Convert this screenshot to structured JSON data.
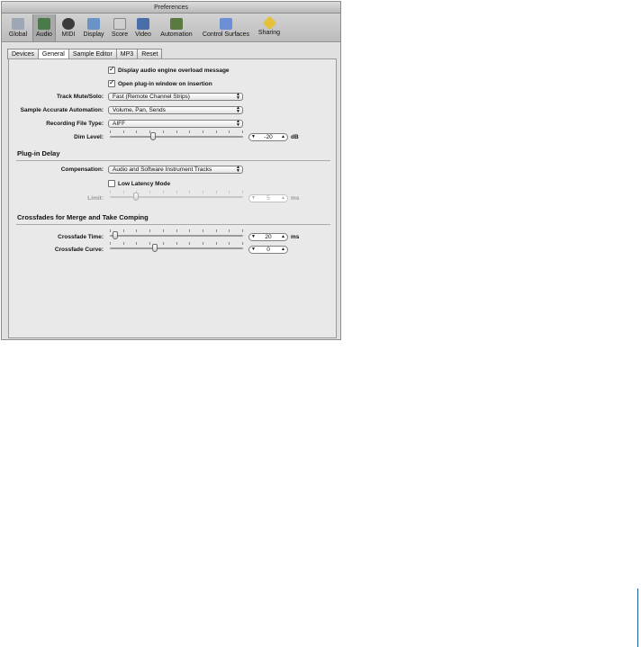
{
  "window": {
    "title": "Preferences"
  },
  "toolbar": [
    {
      "label": "Global",
      "icon": "global-icon",
      "color": "#9ea7b5"
    },
    {
      "label": "Audio",
      "icon": "audio-icon",
      "color": "#4a7a4a"
    },
    {
      "label": "MIDI",
      "icon": "midi-icon",
      "color": "#3b3b3b"
    },
    {
      "label": "Display",
      "icon": "display-icon",
      "color": "#6a93c8"
    },
    {
      "label": "Score",
      "icon": "score-icon",
      "color": "#cfcfcf"
    },
    {
      "label": "Video",
      "icon": "video-icon",
      "color": "#4a6fa8"
    },
    {
      "label": "Automation",
      "icon": "automation-icon",
      "color": "#5b7a40"
    },
    {
      "label": "Control Surfaces",
      "icon": "control-surfaces-icon",
      "color": "#6c8fd6"
    },
    {
      "label": "Sharing",
      "icon": "sharing-icon",
      "color": "#e3c23a"
    }
  ],
  "tabs": [
    "Devices",
    "General",
    "Sample Editor",
    "MP3",
    "Reset"
  ],
  "active_tab": "General",
  "general": {
    "overload_message": {
      "label": "Display audio engine overload message",
      "checked": true
    },
    "plugin_window": {
      "label": "Open plug-in window on insertion",
      "checked": true
    },
    "track_mute_solo": {
      "label": "Track Mute/Solo:",
      "value": "Fast (Remote Channel Strips)"
    },
    "sample_accurate_automation": {
      "label": "Sample Accurate Automation:",
      "value": "Volume, Pan, Sends"
    },
    "recording_file_type": {
      "label": "Recording File Type:",
      "value": "AIFF"
    },
    "dim_level": {
      "label": "Dim Level:",
      "value": "-20",
      "unit": "dB",
      "position": 0.32
    }
  },
  "plugin_delay": {
    "heading": "Plug-in Delay",
    "compensation": {
      "label": "Compensation:",
      "value": "Audio and Software Instrument Tracks"
    },
    "low_latency": {
      "label": "Low Latency Mode",
      "checked": false
    },
    "limit": {
      "label": "Limit:",
      "value": "5",
      "unit": "ms",
      "position": 0.18
    }
  },
  "crossfades": {
    "heading": "Crossfades for Merge and Take Comping",
    "crossfade_time": {
      "label": "Crossfade Time:",
      "value": "20",
      "unit": "ms",
      "position": 0.02
    },
    "crossfade_curve": {
      "label": "Crossfade Curve:",
      "value": "0",
      "position": 0.33
    }
  }
}
